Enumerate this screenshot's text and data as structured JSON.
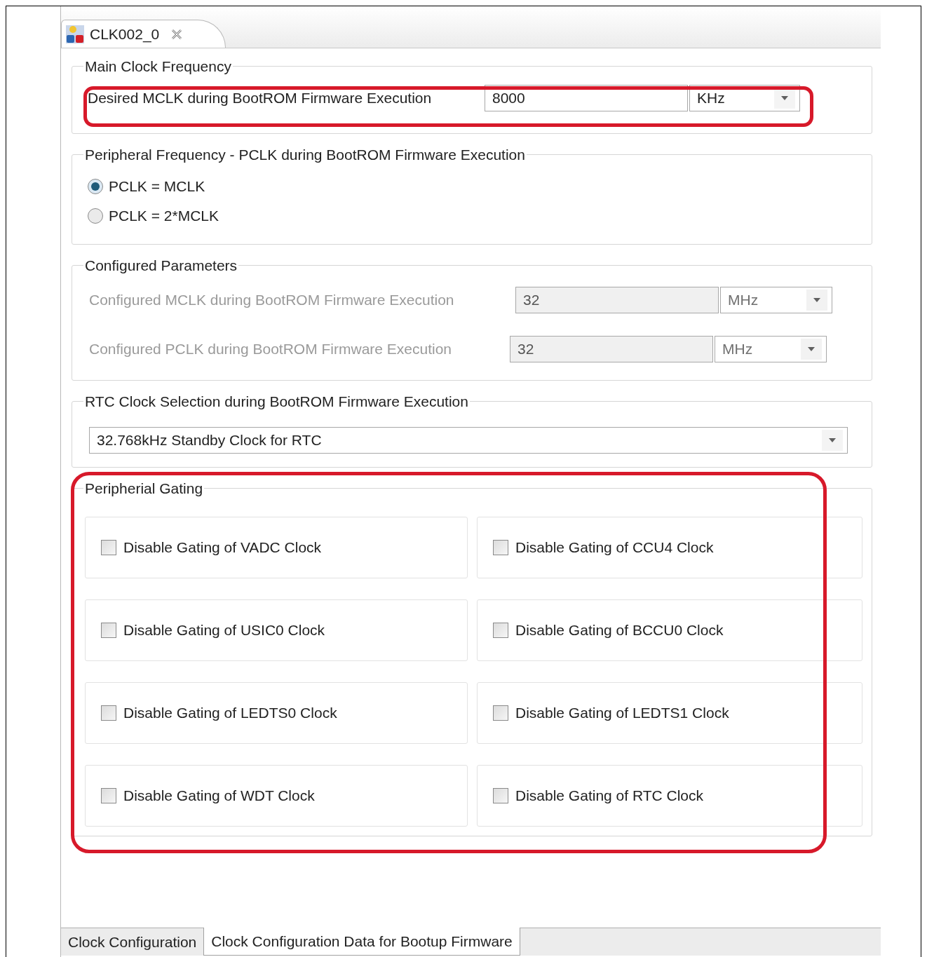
{
  "editor_tab": {
    "label": "CLK002_0",
    "selected": true
  },
  "main_clock": {
    "title": "Main Clock Frequency",
    "label": "Desired MCLK during BootROM Firmware Execution",
    "value": "8000",
    "unit": "KHz"
  },
  "peripheral_frequency": {
    "title": "Peripheral Frequency - PCLK during BootROM Firmware Execution",
    "options": [
      {
        "label": "PCLK = MCLK",
        "selected": true
      },
      {
        "label": "PCLK = 2*MCLK",
        "selected": false
      }
    ]
  },
  "configured_parameters": {
    "title": "Configured Parameters",
    "rows": [
      {
        "label": "Configured MCLK during BootROM Firmware Execution",
        "value": "32",
        "unit": "MHz",
        "disabled": true
      },
      {
        "label": "Configured PCLK during BootROM Firmware Execution",
        "value": "32",
        "unit": "MHz",
        "disabled": true
      }
    ]
  },
  "rtc_clock": {
    "title": "RTC Clock Selection during BootROM Firmware Execution",
    "value": "32.768kHz Standby Clock for RTC"
  },
  "peripheral_gating": {
    "title": "Peripherial Gating",
    "items": [
      {
        "label": "Disable Gating of VADC Clock",
        "checked": false
      },
      {
        "label": "Disable Gating of CCU4 Clock",
        "checked": false
      },
      {
        "label": "Disable Gating of USIC0 Clock",
        "checked": false
      },
      {
        "label": "Disable Gating of BCCU0 Clock",
        "checked": false
      },
      {
        "label": "Disable Gating of LEDTS0 Clock",
        "checked": false
      },
      {
        "label": "Disable Gating of LEDTS1 Clock",
        "checked": false
      },
      {
        "label": "Disable Gating of WDT Clock",
        "checked": false
      },
      {
        "label": "Disable Gating of RTC Clock",
        "checked": false
      }
    ]
  },
  "bottom_tabs": [
    {
      "label": "Clock Configuration",
      "selected": false
    },
    {
      "label": "Clock Configuration Data for Bootup Firmware",
      "selected": true
    }
  ]
}
